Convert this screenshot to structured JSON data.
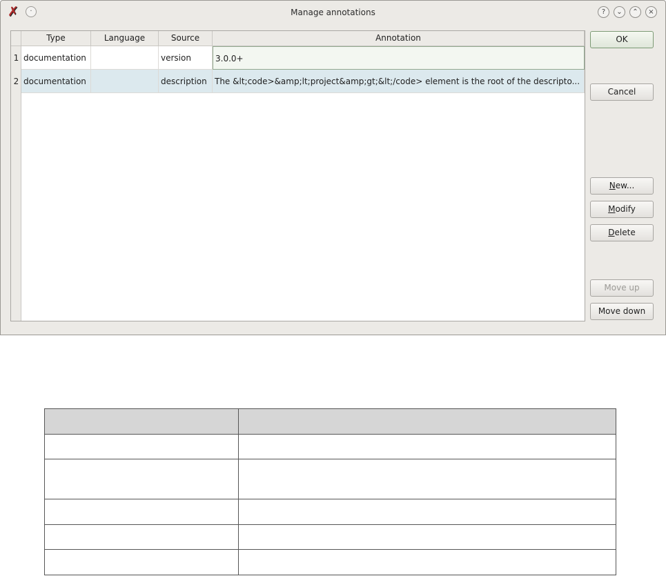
{
  "window": {
    "title": "Manage annotations",
    "icons": {
      "app": "app-x-icon",
      "sticky": "sticky-pin-icon",
      "help": "help-icon",
      "minimize": "minimize-icon",
      "maximize": "maximize-icon",
      "close": "close-icon"
    }
  },
  "table": {
    "columns": [
      "Type",
      "Language",
      "Source",
      "Annotation"
    ],
    "rows": [
      {
        "num": "1",
        "type": "documentation",
        "language": "",
        "source": "version",
        "annotation": "3.0.0+"
      },
      {
        "num": "2",
        "type": "documentation",
        "language": "",
        "source": "description",
        "annotation": "The &lt;code>&amp;lt;project&amp;gt;&lt;/code> element is the root of the descripto..."
      }
    ]
  },
  "buttons": {
    "ok": "OK",
    "cancel": "Cancel",
    "new_mn": "N",
    "new_rest": "ew...",
    "modify_mn": "M",
    "modify_rest": "odify",
    "delete_mn": "D",
    "delete_rest": "elete",
    "move_up": "Move up",
    "move_down": "Move down"
  },
  "colors": {
    "selected_row": "#dce9ee",
    "dialog_bg": "#eceae6",
    "header_fill": "#d6d6d6"
  },
  "doc_table": {
    "headers": [
      "",
      ""
    ],
    "rows": [
      [
        "",
        ""
      ],
      [
        "",
        ""
      ],
      [
        "",
        ""
      ],
      [
        "",
        ""
      ],
      [
        "",
        ""
      ]
    ]
  }
}
